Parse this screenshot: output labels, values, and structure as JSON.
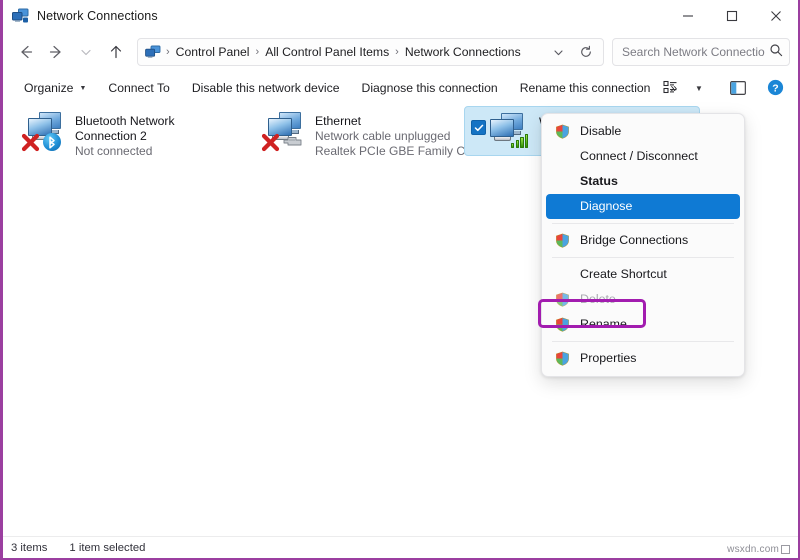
{
  "window": {
    "title": "Network Connections",
    "app_icon": "network-connections-icon",
    "controls": {
      "minimize": "–",
      "maximize": "□",
      "close": "✕"
    }
  },
  "nav": {
    "back": "back-arrow",
    "forward": "forward-arrow",
    "recent": "chevron-down",
    "up": "up-arrow",
    "breadcrumb": [
      "Control Panel",
      "All Control Panel Items",
      "Network Connections"
    ],
    "separator": "›",
    "dropdown_icon": "chevron-down-icon",
    "refresh_icon": "refresh-icon"
  },
  "search": {
    "placeholder": "Search Network Connections",
    "value": "",
    "icon": "search-icon"
  },
  "toolbar": {
    "items": [
      {
        "label": "Organize",
        "has_caret": true
      },
      {
        "label": "Connect To",
        "has_caret": false
      },
      {
        "label": "Disable this network device",
        "has_caret": false
      },
      {
        "label": "Diagnose this connection",
        "has_caret": false
      },
      {
        "label": "Rename this connection",
        "has_caret": false
      }
    ],
    "overflow": "»",
    "view_icon": "view-options-icon",
    "view_caret": "▾",
    "preview_pane_icon": "preview-pane-icon",
    "help_icon": "help-icon"
  },
  "adapters": [
    {
      "name": "Bluetooth Network Connection 2",
      "status": "Not connected",
      "detail": "",
      "icon": "network-adapter-icon",
      "badge": "bluetooth-badge",
      "disabled_mark": "red-x-icon",
      "selected": false
    },
    {
      "name": "Ethernet",
      "status": "Network cable unplugged",
      "detail": "Realtek PCIe GBE Family Contr...",
      "icon": "network-adapter-icon",
      "badge": "ethernet-cable-badge",
      "disabled_mark": "red-x-icon",
      "selected": false
    },
    {
      "name": "Wi-Fi",
      "status": "",
      "detail": "",
      "icon": "network-adapter-icon",
      "badge": "wifi-signal-badge",
      "disabled_mark": "",
      "selected": true
    }
  ],
  "context_menu": {
    "items": [
      {
        "label": "Disable",
        "icon": "shield-icon",
        "state": "normal"
      },
      {
        "label": "Connect / Disconnect",
        "icon": "",
        "state": "normal"
      },
      {
        "label": "Status",
        "icon": "",
        "state": "bold"
      },
      {
        "label": "Diagnose",
        "icon": "",
        "state": "highlighted"
      },
      {
        "separator": true
      },
      {
        "label": "Bridge Connections",
        "icon": "shield-icon",
        "state": "normal"
      },
      {
        "separator": true
      },
      {
        "label": "Create Shortcut",
        "icon": "",
        "state": "normal"
      },
      {
        "label": "Delete",
        "icon": "shield-icon",
        "state": "disabled"
      },
      {
        "label": "Rename",
        "icon": "shield-icon",
        "state": "normal"
      },
      {
        "separator": true
      },
      {
        "label": "Properties",
        "icon": "shield-icon",
        "state": "normal",
        "annotated": true
      }
    ],
    "annotation_color": "#a21caf"
  },
  "status_bar": {
    "item_count": "3 items",
    "selection": "1 item selected"
  },
  "watermark": {
    "text": "wsxdn.com"
  },
  "colors": {
    "accent_blue": "#0f7ad4",
    "selection_blue": "#cde8f7",
    "annotation_purple": "#a21caf",
    "frame_purple": "#9b3fa0"
  }
}
